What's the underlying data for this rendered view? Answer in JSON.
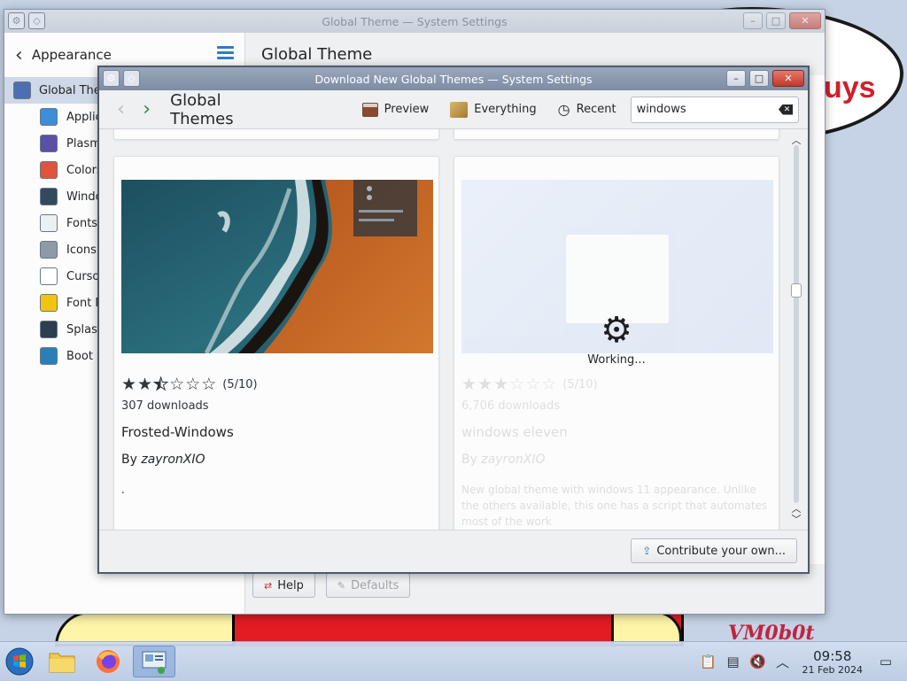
{
  "wallpaper": {
    "bubble_text": "uys",
    "signature": "VM0b0t"
  },
  "settings_window": {
    "title": "Global Theme — System Settings",
    "sidebar_title": "Appearance",
    "content_title": "Global Theme",
    "items": [
      {
        "label": "Global Theme",
        "icon": "global-theme-icon",
        "selected": true
      },
      {
        "label": "Applica",
        "icon": "application-style-icon"
      },
      {
        "label": "Plasma",
        "icon": "plasma-style-icon"
      },
      {
        "label": "Colors",
        "icon": "colors-icon"
      },
      {
        "label": "Windo",
        "icon": "window-decorations-icon"
      },
      {
        "label": "Fonts",
        "icon": "fonts-icon"
      },
      {
        "label": "Icons",
        "icon": "icons-icon"
      },
      {
        "label": "Curso",
        "icon": "cursors-icon"
      },
      {
        "label": "Font M",
        "icon": "font-management-icon"
      },
      {
        "label": "Splash",
        "icon": "splash-screen-icon"
      },
      {
        "label": "Boot S",
        "icon": "boot-splash-icon"
      }
    ],
    "help_label": "Help",
    "defaults_label": "Defaults"
  },
  "dialog": {
    "title": "Download New Global Themes — System Settings",
    "toolbar": {
      "title": "Global Themes",
      "preview_label": "Preview",
      "everything_label": "Everything",
      "recent_label": "Recent",
      "search_value": "windows"
    },
    "cards": [
      {
        "rating_text": "(5/10)",
        "rating_stars": 2.5,
        "downloads": "307 downloads",
        "name": "Frosted-Windows",
        "author_prefix": "By ",
        "author": "zayronXIO",
        "description": "."
      },
      {
        "rating_text": "(5/10)",
        "rating_stars": 2.5,
        "downloads": "6,706 downloads",
        "name": "windows eleven",
        "author_prefix": "By ",
        "author": "zayronXIO",
        "description": "New global theme with windows 11 appearance. Unlike the others available, this one has a script that automates most of the work",
        "working_text": "Working..."
      }
    ],
    "contribute_label": "Contribute your own..."
  },
  "taskbar": {
    "time": "09:58",
    "date": "21 Feb 2024"
  }
}
